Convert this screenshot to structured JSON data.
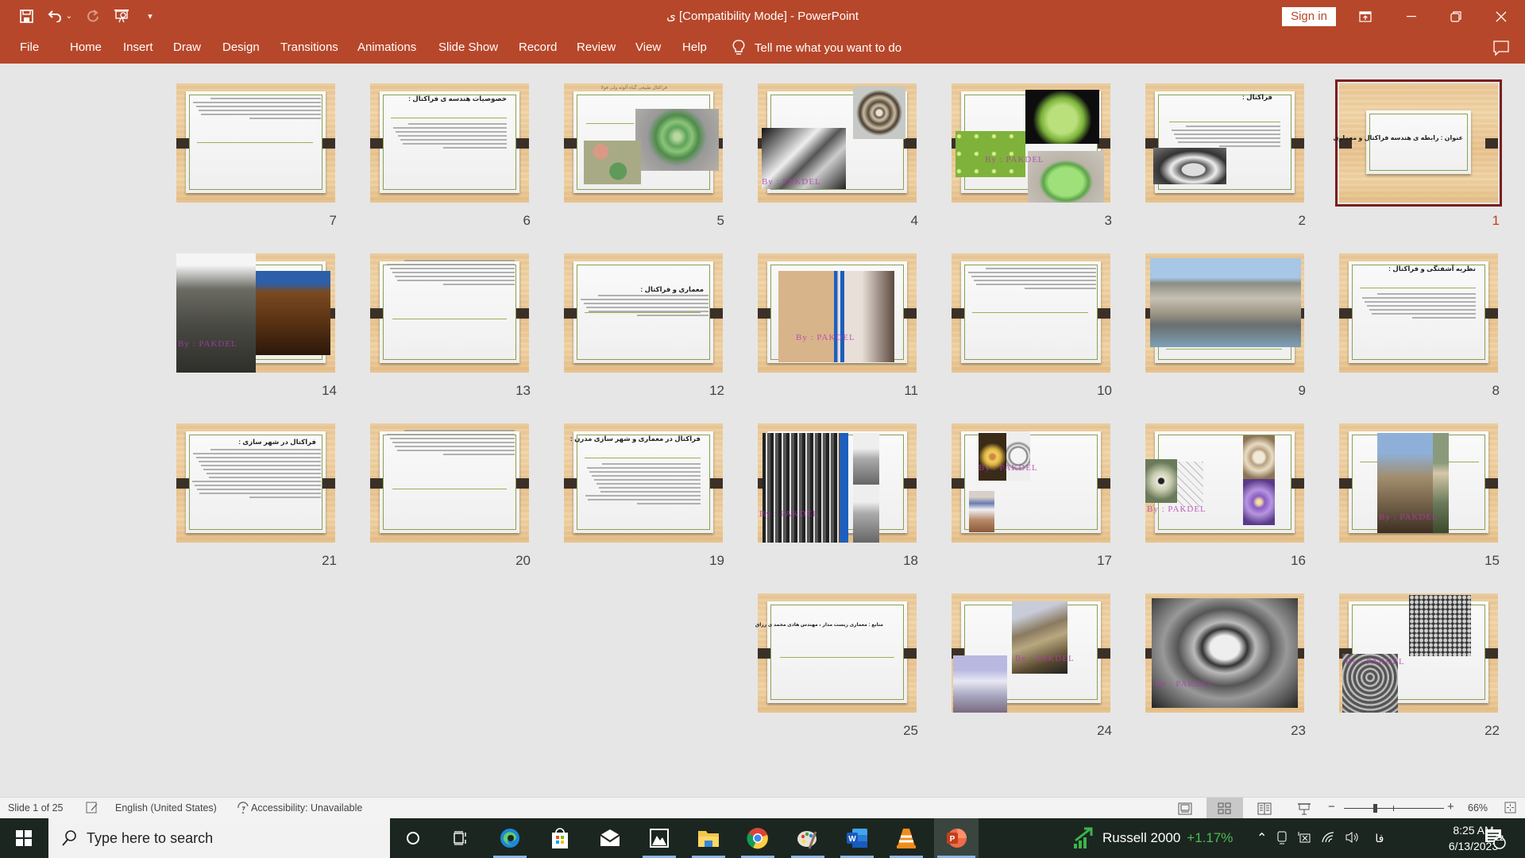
{
  "app": {
    "title": "ی [Compatibility Mode]  -  PowerPoint",
    "sign_in": "Sign in",
    "quick_access": [
      "save-icon",
      "undo-icon",
      "redo-icon",
      "start-from-beginning-icon",
      "customize-qat-icon"
    ],
    "window_controls": [
      "ribbon-display-options-icon",
      "minimize-icon",
      "restore-icon",
      "close-icon"
    ]
  },
  "ribbon": {
    "tabs": [
      "File",
      "Home",
      "Insert",
      "Draw",
      "Design",
      "Transitions",
      "Animations",
      "Slide Show",
      "Record",
      "Review",
      "View",
      "Help"
    ],
    "tell_me": "Tell me what you want to do"
  },
  "sorter": {
    "selected_slide": 1,
    "slides": [
      {
        "num": "1",
        "layout": "title",
        "title": "عنوان : رابطه ی هندسه فراکتال و معماری"
      },
      {
        "num": "2",
        "layout": "text-image",
        "title": "فراکتال :",
        "images": [
          "radiolarian-bw"
        ]
      },
      {
        "num": "3",
        "layout": "images",
        "images": [
          "romanesco-black",
          "romanesco-closeup",
          "romanesco-table"
        ],
        "watermark": "By : PAKDEL"
      },
      {
        "num": "4",
        "layout": "images",
        "images": [
          "snail-shell",
          "frost-bw"
        ],
        "watermark": "By : PAKDEL"
      },
      {
        "num": "5",
        "layout": "images",
        "caption": "فراکتال طبیعی گیاه آلوئه ولی فولا",
        "images": [
          "aloe-spiral",
          "succulent-garden"
        ]
      },
      {
        "num": "6",
        "layout": "bullets",
        "title": "خصوصیات هندسه ی فراکتال :"
      },
      {
        "num": "7",
        "layout": "text",
        "title": ""
      },
      {
        "num": "8",
        "layout": "bullets",
        "title": "نظریه آشفتگی و فراکتال :"
      },
      {
        "num": "9",
        "layout": "image",
        "images": [
          "guggenheim-bilbao"
        ]
      },
      {
        "num": "10",
        "layout": "text",
        "title": ""
      },
      {
        "num": "11",
        "layout": "image",
        "images": [
          "temple-and-sculpture"
        ],
        "watermark": "By : PAKDEL"
      },
      {
        "num": "12",
        "layout": "text",
        "title": "معماری و فراکتال :"
      },
      {
        "num": "13",
        "layout": "text-top",
        "title": ""
      },
      {
        "num": "14",
        "layout": "images",
        "images": [
          "angkor-wat",
          "hindu-temple"
        ],
        "watermark": "By : PAKDEL"
      },
      {
        "num": "15",
        "layout": "images",
        "images": [
          "cathedral-spire",
          "spiral-tower"
        ],
        "watermark": "By : PAKDEL"
      },
      {
        "num": "16",
        "layout": "images",
        "images": [
          "flower",
          "plan-drawing",
          "ceiling-ornament",
          "iris"
        ],
        "watermark": "By : PAKDEL"
      },
      {
        "num": "17",
        "layout": "images",
        "images": [
          "star-flower",
          "ring-plan",
          "onion-domes"
        ],
        "watermark": "By : PAKDEL"
      },
      {
        "num": "18",
        "layout": "images",
        "images": [
          "cactus-bw",
          "dome-bw"
        ],
        "watermark": "By : PAKDEL"
      },
      {
        "num": "19",
        "layout": "bullets",
        "title": "فراکتال در معماری و شهر سازی مدرن :"
      },
      {
        "num": "20",
        "layout": "text-top",
        "title": ""
      },
      {
        "num": "21",
        "layout": "text",
        "title": "فراکتال در شهر سازی :"
      },
      {
        "num": "22",
        "layout": "images",
        "images": [
          "aerial-city",
          "aerial-radial"
        ],
        "watermark": "By : PAKDEL"
      },
      {
        "num": "23",
        "layout": "image",
        "images": [
          "aerial-bw"
        ],
        "watermark": "By : PAKDEL"
      },
      {
        "num": "24",
        "layout": "images",
        "images": [
          "fed-square",
          "disney-hall"
        ],
        "watermark": "By : PAKDEL"
      },
      {
        "num": "25",
        "layout": "source",
        "title": "منابع : معماری زیست مدار ، مهندس هادی محمد ی رزاق"
      }
    ]
  },
  "statusbar": {
    "slide_info": "Slide 1 of 25",
    "language": "English (United States)",
    "accessibility": "Accessibility: Unavailable",
    "views": [
      "normal-view",
      "slide-sorter-view",
      "reading-view",
      "slide-show-view"
    ],
    "active_view": "slide-sorter-view",
    "zoom": "66%",
    "zoom_percent": 66
  },
  "taskbar": {
    "search_placeholder": "Type here to search",
    "apps": [
      "cortana",
      "task-view",
      "edge",
      "store",
      "mail",
      "photos",
      "file-explorer",
      "chrome",
      "paint",
      "word",
      "vlc",
      "powerpoint"
    ],
    "active_app": "powerpoint",
    "ticker_name": "Russell 2000",
    "ticker_change": "+1.17%",
    "input_lang": "فا",
    "time": "8:25 AM",
    "date": "6/13/2023",
    "notifications": "22"
  }
}
